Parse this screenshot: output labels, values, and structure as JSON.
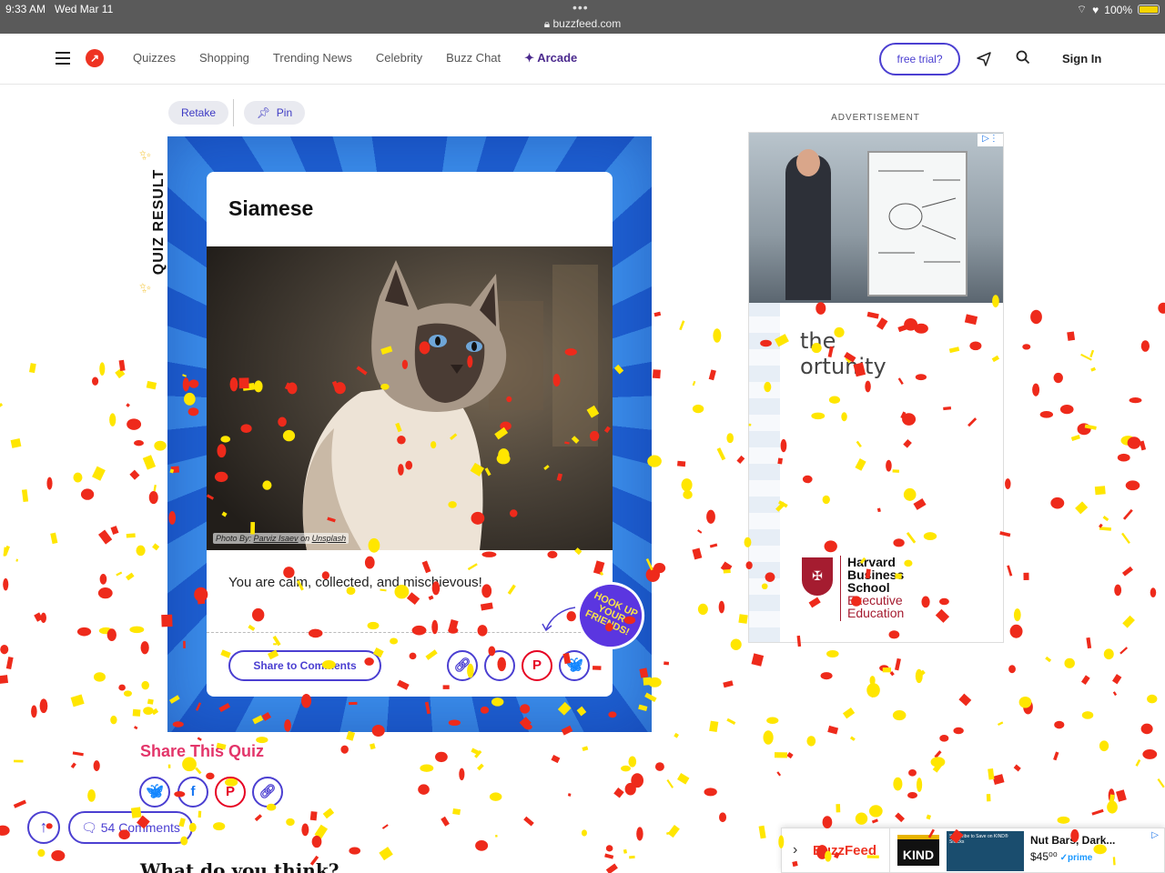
{
  "status_bar": {
    "time": "9:33 AM",
    "date": "Wed Mar 11",
    "url": "buzzfeed.com",
    "battery": "100%"
  },
  "nav": {
    "links": [
      "Quizzes",
      "Shopping",
      "Trending News",
      "Celebrity",
      "Buzz Chat"
    ],
    "arcade": "Arcade",
    "free_trial": "free trial?",
    "sign_in": "Sign In"
  },
  "actions": {
    "retake": "Retake",
    "pin": "Pin"
  },
  "side_label": "QUIZ RESULT",
  "result": {
    "title": "Siamese",
    "credit_prefix": "Photo By: ",
    "credit_author": "Parviz Isaev",
    "credit_on": " on ",
    "credit_site": "Unsplash",
    "description": "You are calm, collected, and mischievous!",
    "hook_badge": "HOOK UP YOUR FRIENDS!",
    "share_to_comments": "Share to Comments"
  },
  "share_quiz": {
    "title": "Share This Quiz"
  },
  "comments": {
    "count_label": "54 Comments"
  },
  "what_do_you_think": "What do you think?",
  "advertisement": {
    "label": "ADVERTISEMENT",
    "headline_line1": "the",
    "headline_line2": "ortunity",
    "brand_line1": "Harvard",
    "brand_line2": "Business",
    "brand_line3": "School",
    "brand_line4": "Executive",
    "brand_line5": "Education"
  },
  "bottom_ad": {
    "brand": "BuzzFeed",
    "kind_logo": "KIND",
    "promo_text": "Subscribe to Save on KIND® Snacks",
    "product": "Nut Bars, Dark...",
    "price": "$45⁰⁰",
    "prime": "✓prime"
  },
  "colors": {
    "accent": "#4b3fd1",
    "buzzfeed_red": "#e32222",
    "share_title": "#e3356a",
    "burst_dark": "#1e5fd0",
    "burst_light": "#3a8be8",
    "confetti_red": "#ee2a1b",
    "confetti_yellow": "#ffe600"
  }
}
